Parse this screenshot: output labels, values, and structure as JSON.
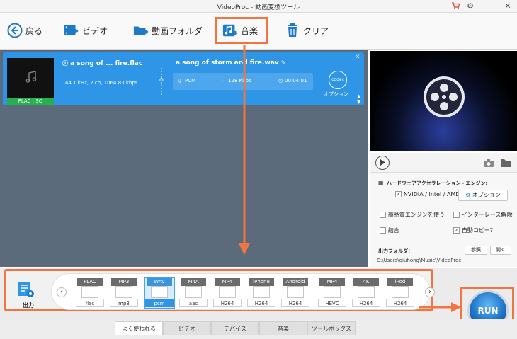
{
  "titlebar": {
    "title": "VideoProc - 動画変換ツール"
  },
  "toolbar": {
    "back": "戻る",
    "video": "ビデオ",
    "folder": "動画フォルダ",
    "music": "音楽",
    "clear": "クリア"
  },
  "file": {
    "input_name": "a song of ... fire.flac",
    "input_info": "44.1 kHz, 2 ch, 1064.83 kbps",
    "badge": "FLAC | SQ",
    "output_name": "a song of storm and fire.wav",
    "codec": "PCM",
    "bitrate": "128 Kbps",
    "duration": "00:04:01",
    "codec_icon": "codec",
    "option_label": "オプション"
  },
  "hw": {
    "title": "ハードウェアアクセラレーション・エンジン:",
    "nvidia": "NVIDIA / Intel / AMD",
    "option_btn": "オプション",
    "hq_engine": "高品質エンジンを使う",
    "deinterlace": "インターレース解除",
    "merge": "結合",
    "autocopy": "自動コピー？",
    "output_folder_label": "出力フォルダ：",
    "browse": "参照",
    "open": "開く",
    "output_path": "C:\\Users\\qiuhong\\Music\\VideoProc"
  },
  "formats": {
    "output_label": "出力",
    "items": [
      {
        "top": "FLAC",
        "bottom": "flac"
      },
      {
        "top": "MP3",
        "bottom": "mp3"
      },
      {
        "top": "WAV",
        "bottom": "pcm"
      },
      {
        "top": "M4A",
        "bottom": "aac"
      },
      {
        "top": "MP4",
        "bottom": "H264"
      },
      {
        "top": "iPhone",
        "bottom": "H264"
      },
      {
        "top": "Android",
        "bottom": "H264"
      },
      {
        "top": "MP4",
        "bottom": "HEVC"
      },
      {
        "top": "4K",
        "bottom": "H264"
      },
      {
        "top": "iPod",
        "bottom": "H264"
      }
    ]
  },
  "tabs": [
    "よく使われる",
    "ビデオ",
    "デバイス",
    "音楽",
    "ツールボックス"
  ],
  "run_label": "RUN",
  "colors": {
    "accent": "#2f95e6",
    "highlight": "#f2743e"
  }
}
